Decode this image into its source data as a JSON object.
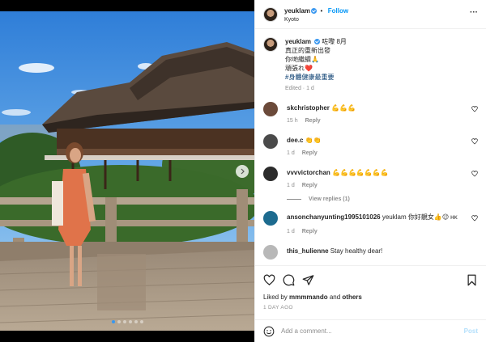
{
  "post": {
    "username": "yeuklam",
    "follow_label": "Follow",
    "location": "Kyoto",
    "caption_lines": [
      "咗嚟 8月",
      "真正的重新出發",
      "你哋繼續🙏",
      "頑張れ❤️"
    ],
    "hashtag": "#身體健康最重要",
    "edited_label": "Edited",
    "edited_age": "1 d"
  },
  "comments": [
    {
      "username": "skchristopher",
      "text": "💪💪💪",
      "age": "15 h",
      "reply_label": "Reply",
      "avatar_color": "#6b4a3a"
    },
    {
      "username": "dee.c",
      "text": "👏👏",
      "age": "1 d",
      "reply_label": "Reply",
      "avatar_color": "#4a4a4a"
    },
    {
      "username": "vvvvictorchan",
      "text": "💪💪💪💪💪💪💪",
      "age": "1 d",
      "reply_label": "Reply",
      "avatar_color": "#2b2b2b",
      "view_replies": "View replies (1)"
    },
    {
      "username": "ansonchanyunting1995101026",
      "text": "yeuklam 你好靚女👍😉",
      "flag": "HK",
      "age": "1 d",
      "reply_label": "Reply",
      "avatar_color": "#1d6b8f"
    },
    {
      "username": "this_hulienne",
      "text": "Stay healthy dear!",
      "avatar_color": "#b8b8b8"
    }
  ],
  "likes": {
    "prefix": "Liked by",
    "user": "mmmmando",
    "and": "and",
    "others": "others"
  },
  "timestamp": "1 DAY AGO",
  "add_comment": {
    "placeholder": "Add a comment...",
    "post_label": "Post"
  },
  "carousel": {
    "count": 6,
    "active_index": 0
  },
  "colors": {
    "accent": "#0095f6",
    "verified": "#3897f0",
    "link": "#00376b"
  },
  "icons": [
    "more-options-icon",
    "verified-icon",
    "heart-icon",
    "comment-icon",
    "share-icon",
    "bookmark-icon",
    "emoji-icon",
    "chevron-right-icon"
  ]
}
